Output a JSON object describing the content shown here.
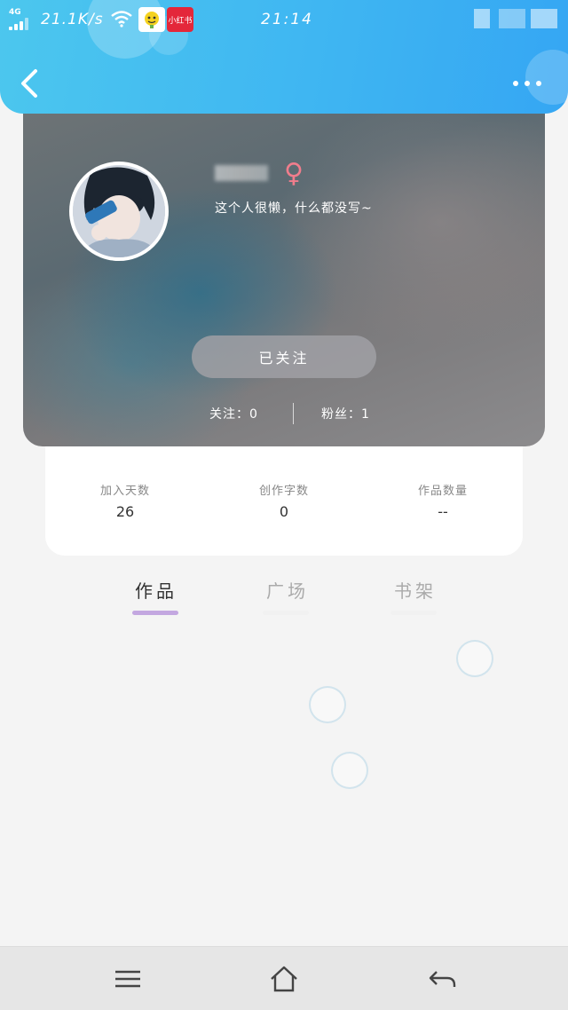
{
  "status_bar": {
    "network": "4G",
    "speed": "21.1K/s",
    "time": "21:14",
    "app_badge_2": "小红书"
  },
  "header": {
    "back_icon": "chevron-left-icon",
    "more_icon": "more-horizontal-icon",
    "color_start": "#4cc7ee",
    "color_end": "#35a6f3"
  },
  "profile": {
    "gender_symbol": "♀",
    "gender_color": "#f07d8c",
    "bio": "这个人很懒，什么都没写~",
    "follow_button": "已关注",
    "following": "关注：0",
    "fans": "粉丝：1"
  },
  "stats": [
    {
      "label": "加入天数",
      "value": "26"
    },
    {
      "label": "创作字数",
      "value": "0"
    },
    {
      "label": "作品数量",
      "value": "--"
    }
  ],
  "tabs": [
    {
      "label": "作品",
      "active": true
    },
    {
      "label": "广场",
      "active": false
    },
    {
      "label": "书架",
      "active": false
    }
  ],
  "tab_indicator_color": "#c3a7e0",
  "navbar": {
    "menu_icon": "menu-icon",
    "home_icon": "home-icon",
    "back_icon": "back-arrow-icon"
  }
}
